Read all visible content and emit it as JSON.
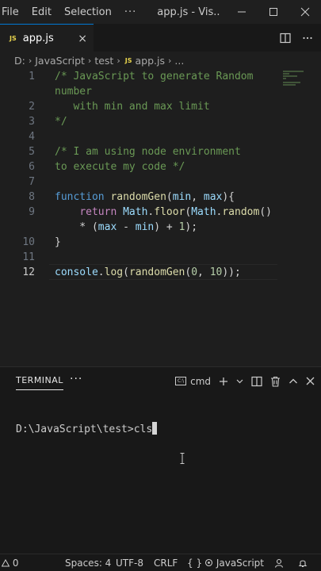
{
  "titlebar": {
    "menus": [
      "File",
      "Edit",
      "Selection"
    ],
    "more": "···",
    "title": "app.js - Vis..."
  },
  "tab": {
    "badge": "JS",
    "label": "app.js",
    "close": "×"
  },
  "breadcrumb": {
    "parts": [
      "D:",
      "JavaScript",
      "test"
    ],
    "badge": "JS",
    "file": "app.js",
    "tail": "..."
  },
  "editor": {
    "lines": [
      {
        "n": "1",
        "tokens": [
          {
            "t": "/* JavaScript to generate Random",
            "c": "cm"
          }
        ]
      },
      {
        "n": "",
        "tokens": [
          {
            "t": "number",
            "c": "cm"
          }
        ]
      },
      {
        "n": "2",
        "tokens": [
          {
            "t": "   with min and max limit",
            "c": "cm"
          }
        ]
      },
      {
        "n": "3",
        "tokens": [
          {
            "t": "*/",
            "c": "cm"
          }
        ]
      },
      {
        "n": "4",
        "tokens": []
      },
      {
        "n": "5",
        "tokens": [
          {
            "t": "/* I am using node environment",
            "c": "cm"
          }
        ]
      },
      {
        "n": "6",
        "tokens": [
          {
            "t": "to execute my code */",
            "c": "cm"
          }
        ]
      },
      {
        "n": "7",
        "tokens": []
      },
      {
        "n": "8",
        "tokens": [
          {
            "t": "function",
            "c": "kw"
          },
          {
            "t": " ",
            "c": "pl"
          },
          {
            "t": "randomGen",
            "c": "fn"
          },
          {
            "t": "(",
            "c": "pl"
          },
          {
            "t": "min",
            "c": "var"
          },
          {
            "t": ", ",
            "c": "pl"
          },
          {
            "t": "max",
            "c": "var"
          },
          {
            "t": "){",
            "c": "pl"
          }
        ]
      },
      {
        "n": "9",
        "tokens": [
          {
            "t": "    ",
            "c": "pl"
          },
          {
            "t": "return",
            "c": "kw2"
          },
          {
            "t": " ",
            "c": "pl"
          },
          {
            "t": "Math",
            "c": "var"
          },
          {
            "t": ".",
            "c": "pl"
          },
          {
            "t": "floor",
            "c": "fn"
          },
          {
            "t": "(",
            "c": "pl"
          },
          {
            "t": "Math",
            "c": "var"
          },
          {
            "t": ".",
            "c": "pl"
          },
          {
            "t": "random",
            "c": "fn"
          },
          {
            "t": "()",
            "c": "pl"
          }
        ]
      },
      {
        "n": "",
        "tokens": [
          {
            "t": "    * (",
            "c": "pl"
          },
          {
            "t": "max",
            "c": "var"
          },
          {
            "t": " - ",
            "c": "pl"
          },
          {
            "t": "min",
            "c": "var"
          },
          {
            "t": ") + ",
            "c": "pl"
          },
          {
            "t": "1",
            "c": "num"
          },
          {
            "t": ");",
            "c": "pl"
          }
        ]
      },
      {
        "n": "10",
        "tokens": [
          {
            "t": "}",
            "c": "pl"
          }
        ]
      },
      {
        "n": "11",
        "tokens": []
      },
      {
        "n": "12",
        "tokens": [
          {
            "t": "console",
            "c": "var"
          },
          {
            "t": ".",
            "c": "pl"
          },
          {
            "t": "log",
            "c": "fn"
          },
          {
            "t": "(",
            "c": "pl"
          },
          {
            "t": "randomGen",
            "c": "fn"
          },
          {
            "t": "(",
            "c": "pl"
          },
          {
            "t": "0",
            "c": "num"
          },
          {
            "t": ", ",
            "c": "pl"
          },
          {
            "t": "10",
            "c": "num"
          },
          {
            "t": "));",
            "c": "pl"
          }
        ],
        "active": true
      }
    ]
  },
  "panel": {
    "tab_label": "TERMINAL",
    "more": "···",
    "shell": "cmd",
    "shell_icon_text": "C:\\",
    "terminal_line": "D:\\JavaScript\\test>cls"
  },
  "status": {
    "problems": "0",
    "spaces": "Spaces: 4",
    "encoding": "UTF-8",
    "eol": "CRLF",
    "braces": "{ }",
    "language": "JavaScript"
  },
  "colors": {
    "accent": "#0078d4",
    "comment": "#6a9955",
    "keyword": "#569cd6",
    "function": "#dcdcaa",
    "variable": "#9cdcfe",
    "number": "#b5cea8"
  }
}
